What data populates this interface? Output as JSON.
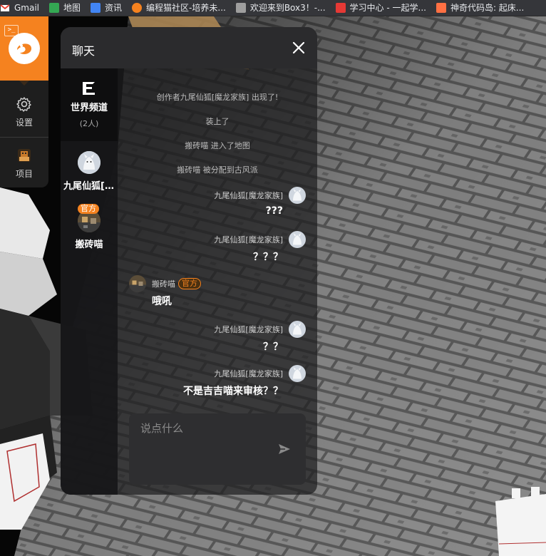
{
  "bookmarks": [
    {
      "label": "Gmail",
      "color": "#ea4335",
      "icon": "gmail-icon"
    },
    {
      "label": "地图",
      "color": "#34a853",
      "icon": "maps-icon"
    },
    {
      "label": "资讯",
      "color": "#4285f4",
      "icon": "news-icon"
    },
    {
      "label": "编程猫社区-培养未...",
      "color": "#f5821f",
      "icon": "codemao-icon"
    },
    {
      "label": "欢迎来到Box3！-...",
      "color": "#9e9e9e",
      "icon": "box3-icon"
    },
    {
      "label": "学习中心 - 一起学...",
      "color": "#e53935",
      "icon": "learning-icon"
    },
    {
      "label": "神奇代码岛: 起床...",
      "color": "#ff7043",
      "icon": "dao3-icon"
    }
  ],
  "toolbar": {
    "settings_label": "设置",
    "projects_label": "项目",
    "accent": "#f5821f"
  },
  "chat": {
    "title": "聊天",
    "channel": {
      "name": "世界频道",
      "count": "(2人)"
    },
    "members": [
      {
        "name": "九尾仙狐[魔龙家族]",
        "badge": ""
      },
      {
        "name": "搬砖喵",
        "badge": "官方"
      }
    ],
    "system_messages": [
      "创作者九尾仙狐[魔龙家族] 出现了!",
      "装上了",
      "搬砖喵 进入了地图",
      "搬砖喵 被分配到古风派"
    ],
    "messages": [
      {
        "side": "right",
        "user": "九尾仙狐[魔龙家族]",
        "text": "???"
      },
      {
        "side": "right",
        "user": "九尾仙狐[魔龙家族]",
        "text": "？？？"
      },
      {
        "side": "left",
        "user": "搬砖喵",
        "badge": "官方",
        "text": "哦吼"
      },
      {
        "side": "right",
        "user": "九尾仙狐[魔龙家族]",
        "text": "？？"
      },
      {
        "side": "right",
        "user": "九尾仙狐[魔龙家族]",
        "text": "不是吉吉喵来审核？？"
      }
    ],
    "input": {
      "placeholder": "说点什么",
      "value": ""
    }
  }
}
